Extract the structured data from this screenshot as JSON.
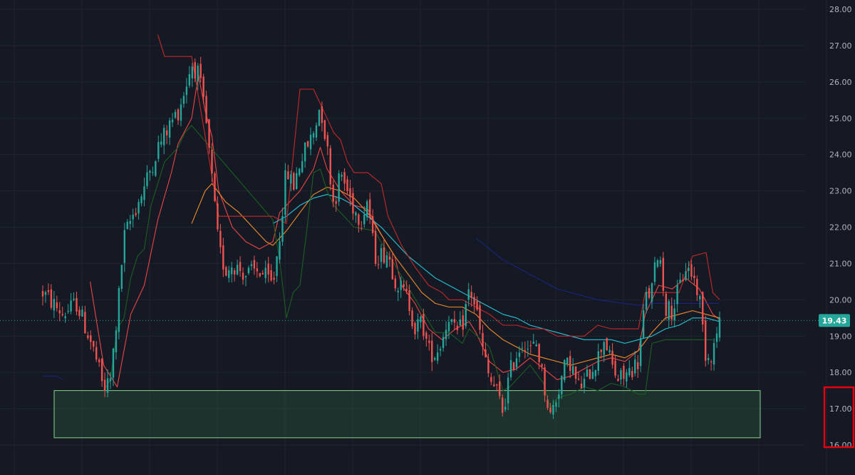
{
  "chart_data": {
    "type": "candlestick",
    "y_axis": {
      "ylim": [
        15.8,
        28.2
      ],
      "tick_labels": [
        "16.00",
        "17.00",
        "18.00",
        "19.00",
        "20.00",
        "21.00",
        "22.00",
        "23.00",
        "24.00",
        "25.00",
        "26.00",
        "27.00",
        "28.00"
      ],
      "grid": true,
      "position": "right"
    },
    "current_price": {
      "label": "19.43",
      "value": 19.43
    },
    "support_zone": {
      "low": 16.2,
      "high": 17.5
    },
    "x_count": 100,
    "price_path": [
      [
        0,
        20.2
      ],
      [
        3,
        19.6
      ],
      [
        5,
        19.9
      ],
      [
        7,
        18.9
      ],
      [
        8,
        18.3
      ],
      [
        9,
        17.5
      ],
      [
        10,
        17.8
      ],
      [
        11,
        19.6
      ],
      [
        12,
        21.7
      ],
      [
        13,
        22.2
      ],
      [
        15,
        23.1
      ],
      [
        17,
        24.2
      ],
      [
        19,
        24.9
      ],
      [
        20,
        25.2
      ],
      [
        21,
        25.8
      ],
      [
        22,
        26.5
      ],
      [
        23,
        26.2
      ],
      [
        24,
        25.1
      ],
      [
        25,
        23.3
      ],
      [
        26,
        21.4
      ],
      [
        27,
        20.8
      ],
      [
        28,
        21.0
      ],
      [
        30,
        20.7
      ],
      [
        32,
        20.8
      ],
      [
        34,
        20.4
      ],
      [
        35,
        21.8
      ],
      [
        36,
        23.6
      ],
      [
        37,
        23.1
      ],
      [
        38,
        23.8
      ],
      [
        40,
        24.6
      ],
      [
        41,
        25.4
      ],
      [
        42,
        24.2
      ],
      [
        43,
        22.6
      ],
      [
        44,
        23.5
      ],
      [
        46,
        22.5
      ],
      [
        47,
        22.2
      ],
      [
        48,
        22.8
      ],
      [
        49,
        21.2
      ],
      [
        51,
        21.3
      ],
      [
        52,
        20.6
      ],
      [
        54,
        20.0
      ],
      [
        55,
        19.2
      ],
      [
        56,
        19.4
      ],
      [
        57,
        18.6
      ],
      [
        58,
        18.5
      ],
      [
        59,
        18.9
      ],
      [
        60,
        19.6
      ],
      [
        61,
        19.0
      ],
      [
        62,
        19.3
      ],
      [
        63,
        20.3
      ],
      [
        64,
        19.8
      ],
      [
        65,
        18.6
      ],
      [
        66,
        17.8
      ],
      [
        67,
        17.5
      ],
      [
        68,
        16.9
      ],
      [
        69,
        18.0
      ],
      [
        70,
        18.5
      ],
      [
        71,
        18.9
      ],
      [
        72,
        18.6
      ],
      [
        73,
        18.8
      ],
      [
        74,
        17.7
      ],
      [
        75,
        16.8
      ],
      [
        76,
        17.4
      ],
      [
        77,
        18.1
      ],
      [
        78,
        18.3
      ],
      [
        79,
        17.6
      ],
      [
        80,
        17.7
      ],
      [
        81,
        18.1
      ],
      [
        82,
        18.4
      ],
      [
        83,
        19.0
      ],
      [
        84,
        18.2
      ],
      [
        85,
        17.8
      ],
      [
        86,
        17.9
      ],
      [
        87,
        18.1
      ],
      [
        88,
        18.3
      ],
      [
        89,
        20.0
      ],
      [
        90,
        20.3
      ],
      [
        91,
        21.5
      ],
      [
        92,
        19.8
      ],
      [
        93,
        19.7
      ],
      [
        94,
        20.3
      ],
      [
        95,
        20.9
      ],
      [
        96,
        20.7
      ],
      [
        97,
        20.1
      ],
      [
        98,
        18.4
      ],
      [
        99,
        18.6
      ],
      [
        100,
        19.43
      ]
    ],
    "indicators": [
      {
        "color": "#ef4444",
        "points": [
          [
            7,
            20.5
          ],
          [
            9,
            18.2
          ],
          [
            11,
            17.6
          ],
          [
            13,
            19.6
          ],
          [
            15,
            20.4
          ],
          [
            17,
            22.2
          ],
          [
            19,
            23.5
          ],
          [
            20,
            24.3
          ],
          [
            22,
            25.0
          ],
          [
            23,
            26.2
          ],
          [
            24,
            25.2
          ],
          [
            25,
            24.5
          ],
          [
            26,
            23.0
          ],
          [
            28,
            22.0
          ],
          [
            30,
            21.6
          ],
          [
            32,
            21.4
          ],
          [
            34,
            21.6
          ],
          [
            35,
            22.4
          ],
          [
            37,
            22.8
          ],
          [
            38,
            23.0
          ],
          [
            40,
            23.6
          ],
          [
            41,
            24.2
          ],
          [
            42,
            23.6
          ],
          [
            44,
            23.0
          ],
          [
            46,
            22.6
          ],
          [
            48,
            22.5
          ],
          [
            50,
            21.8
          ],
          [
            52,
            21.2
          ],
          [
            53,
            20.4
          ],
          [
            55,
            19.9
          ],
          [
            57,
            19.2
          ],
          [
            59,
            18.9
          ],
          [
            61,
            19.2
          ],
          [
            63,
            19.4
          ],
          [
            64,
            19.1
          ],
          [
            66,
            18.3
          ],
          [
            68,
            18.0
          ],
          [
            70,
            18.1
          ],
          [
            72,
            18.4
          ],
          [
            74,
            18.1
          ],
          [
            76,
            17.8
          ],
          [
            78,
            17.9
          ],
          [
            80,
            18.1
          ],
          [
            82,
            18.3
          ],
          [
            84,
            18.4
          ],
          [
            86,
            18.3
          ],
          [
            88,
            18.6
          ],
          [
            89,
            19.6
          ],
          [
            91,
            20.4
          ],
          [
            93,
            20.3
          ],
          [
            95,
            20.6
          ],
          [
            97,
            20.3
          ],
          [
            99,
            19.6
          ],
          [
            100,
            19.45
          ]
        ]
      },
      {
        "color": "#f28c28",
        "points": [
          [
            22,
            22.1
          ],
          [
            24,
            23.0
          ],
          [
            25,
            23.2
          ],
          [
            27,
            22.7
          ],
          [
            29,
            22.4
          ],
          [
            31,
            22.0
          ],
          [
            33,
            21.6
          ],
          [
            34,
            21.5
          ],
          [
            36,
            21.9
          ],
          [
            38,
            22.4
          ],
          [
            40,
            22.9
          ],
          [
            42,
            23.1
          ],
          [
            44,
            23.0
          ],
          [
            46,
            22.8
          ],
          [
            48,
            22.4
          ],
          [
            50,
            21.8
          ],
          [
            52,
            21.2
          ],
          [
            54,
            20.7
          ],
          [
            56,
            20.2
          ],
          [
            58,
            19.9
          ],
          [
            60,
            19.8
          ],
          [
            62,
            19.8
          ],
          [
            64,
            19.6
          ],
          [
            66,
            19.2
          ],
          [
            68,
            18.9
          ],
          [
            70,
            18.7
          ],
          [
            72,
            18.5
          ],
          [
            74,
            18.4
          ],
          [
            76,
            18.3
          ],
          [
            78,
            18.2
          ],
          [
            80,
            18.3
          ],
          [
            82,
            18.4
          ],
          [
            84,
            18.5
          ],
          [
            86,
            18.4
          ],
          [
            88,
            18.6
          ],
          [
            90,
            19.1
          ],
          [
            92,
            19.5
          ],
          [
            94,
            19.6
          ],
          [
            96,
            19.7
          ],
          [
            98,
            19.6
          ],
          [
            100,
            19.5
          ]
        ]
      },
      {
        "color": "#26c6da",
        "points": [
          [
            34,
            22.1
          ],
          [
            36,
            22.3
          ],
          [
            38,
            22.6
          ],
          [
            40,
            22.8
          ],
          [
            42,
            22.9
          ],
          [
            44,
            22.8
          ],
          [
            46,
            22.6
          ],
          [
            48,
            22.3
          ],
          [
            50,
            22.0
          ],
          [
            52,
            21.6
          ],
          [
            54,
            21.2
          ],
          [
            56,
            20.9
          ],
          [
            58,
            20.6
          ],
          [
            60,
            20.4
          ],
          [
            62,
            20.2
          ],
          [
            64,
            20.0
          ],
          [
            66,
            19.8
          ],
          [
            68,
            19.6
          ],
          [
            70,
            19.5
          ],
          [
            72,
            19.3
          ],
          [
            74,
            19.2
          ],
          [
            76,
            19.1
          ],
          [
            78,
            19.0
          ],
          [
            80,
            18.9
          ],
          [
            82,
            18.9
          ],
          [
            84,
            18.9
          ],
          [
            86,
            18.8
          ],
          [
            88,
            18.9
          ],
          [
            90,
            19.0
          ],
          [
            92,
            19.2
          ],
          [
            94,
            19.3
          ],
          [
            96,
            19.5
          ],
          [
            98,
            19.5
          ],
          [
            100,
            19.4
          ]
        ]
      },
      {
        "color": "#1a237e",
        "points": [
          [
            64,
            21.7
          ],
          [
            66,
            21.4
          ],
          [
            68,
            21.1
          ],
          [
            70,
            20.9
          ],
          [
            72,
            20.7
          ],
          [
            74,
            20.5
          ],
          [
            76,
            20.3
          ],
          [
            78,
            20.2
          ],
          [
            80,
            20.1
          ],
          [
            82,
            20.0
          ],
          [
            84,
            19.95
          ],
          [
            86,
            19.9
          ],
          [
            88,
            19.85
          ],
          [
            90,
            19.9
          ],
          [
            92,
            19.9
          ],
          [
            94,
            19.9
          ],
          [
            96,
            19.9
          ],
          [
            98,
            19.9
          ],
          [
            100,
            19.9
          ]
        ]
      },
      {
        "color": "#1a237e",
        "points": [
          [
            0,
            17.9
          ],
          [
            2,
            17.9
          ],
          [
            3,
            17.8
          ]
        ]
      },
      {
        "color": "#1b5e20",
        "points": [
          [
            9,
            17.5
          ],
          [
            10,
            17.8
          ],
          [
            11,
            19.2
          ],
          [
            12,
            19.5
          ],
          [
            13,
            20.6
          ],
          [
            14,
            21.2
          ],
          [
            15,
            21.4
          ],
          [
            16,
            22.6
          ],
          [
            17,
            23.2
          ],
          [
            18,
            23.8
          ],
          [
            19,
            24.0
          ],
          [
            20,
            24.2
          ],
          [
            21,
            24.6
          ],
          [
            22,
            24.8
          ],
          [
            34,
            22.2
          ],
          [
            35,
            21.1
          ],
          [
            36,
            19.5
          ],
          [
            37,
            20.2
          ],
          [
            38,
            20.4
          ],
          [
            39,
            21.9
          ],
          [
            40,
            23.5
          ],
          [
            41,
            23.6
          ],
          [
            42,
            23.0
          ],
          [
            43,
            22.6
          ],
          [
            44,
            22.4
          ],
          [
            45,
            22.2
          ],
          [
            46,
            22.0
          ],
          [
            49,
            21.9
          ],
          [
            58,
            19.1
          ],
          [
            60,
            19.1
          ],
          [
            62,
            18.8
          ],
          [
            63,
            19.2
          ],
          [
            66,
            18.7
          ],
          [
            68,
            17.5
          ],
          [
            69,
            17.6
          ],
          [
            70,
            17.8
          ],
          [
            72,
            18.2
          ],
          [
            74,
            17.7
          ],
          [
            75,
            17.0
          ],
          [
            76,
            17.3
          ],
          [
            78,
            17.4
          ],
          [
            80,
            17.6
          ],
          [
            82,
            17.5
          ],
          [
            84,
            17.7
          ],
          [
            86,
            17.6
          ],
          [
            88,
            17.4
          ],
          [
            89,
            17.4
          ],
          [
            90,
            18.8
          ],
          [
            92,
            18.9
          ],
          [
            96,
            18.9
          ],
          [
            99,
            18.9
          ]
        ]
      },
      {
        "color": "#c62828",
        "points": [
          [
            17,
            27.3
          ],
          [
            18,
            26.7
          ],
          [
            20,
            26.7
          ],
          [
            22,
            26.7
          ],
          [
            24,
            24.5
          ],
          [
            25,
            23.4
          ],
          [
            26,
            22.3
          ],
          [
            32,
            22.3
          ],
          [
            34,
            22.3
          ],
          [
            36,
            22.1
          ],
          [
            38,
            25.8
          ],
          [
            40,
            25.8
          ],
          [
            42,
            25.0
          ],
          [
            43,
            24.6
          ],
          [
            44,
            24.4
          ],
          [
            45,
            23.8
          ],
          [
            46,
            23.5
          ],
          [
            48,
            23.5
          ],
          [
            50,
            23.2
          ],
          [
            51,
            22.3
          ],
          [
            53,
            21.5
          ],
          [
            55,
            20.9
          ],
          [
            57,
            20.4
          ],
          [
            59,
            20.2
          ],
          [
            60,
            20.0
          ],
          [
            62,
            20.0
          ],
          [
            64,
            19.8
          ],
          [
            66,
            19.6
          ],
          [
            68,
            19.3
          ],
          [
            70,
            19.3
          ],
          [
            72,
            19.2
          ],
          [
            74,
            19.2
          ],
          [
            76,
            19.0
          ],
          [
            78,
            19.0
          ],
          [
            80,
            19.0
          ],
          [
            82,
            19.3
          ],
          [
            84,
            19.2
          ],
          [
            86,
            19.2
          ],
          [
            88,
            19.2
          ],
          [
            89,
            20.2
          ],
          [
            90,
            20.2
          ],
          [
            92,
            20.2
          ],
          [
            94,
            20.2
          ],
          [
            96,
            21.2
          ],
          [
            98,
            21.3
          ],
          [
            99,
            20.2
          ],
          [
            100,
            20.0
          ]
        ]
      }
    ]
  },
  "colors": {
    "background": "#151924",
    "grid": "#1f2431",
    "up": "#26a69a",
    "down": "#ef5350",
    "zone_fill": "rgba(46, 94, 62, 0.35)",
    "zone_stroke": "#8bd18f",
    "price_tag_bg": "#26a69a",
    "highlight_box": "#e3000f"
  }
}
